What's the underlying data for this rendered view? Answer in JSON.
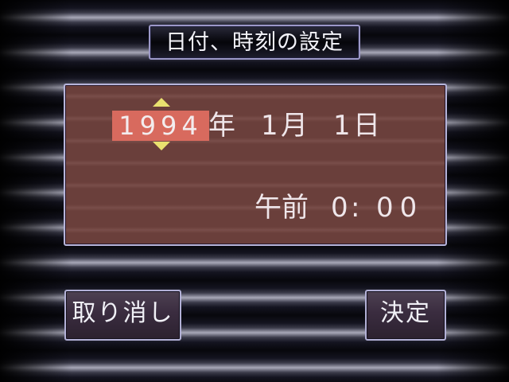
{
  "title": "日付、時刻の設定",
  "date": {
    "year": "1994",
    "year_unit": "年",
    "month": "1",
    "month_unit": "月",
    "day": "1",
    "day_unit": "日"
  },
  "time": {
    "period": "午前",
    "hour": "0",
    "separator": ":",
    "minute": "00"
  },
  "buttons": {
    "cancel_label": "取り消し",
    "ok_label": "決定"
  },
  "colors": {
    "panel": "#6a3f3b",
    "selection": "#d86a5e",
    "arrow": "#e9e16f",
    "border": "#b6b4da"
  },
  "icons": {
    "increment": "triangle-up-icon",
    "decrement": "triangle-down-icon"
  }
}
